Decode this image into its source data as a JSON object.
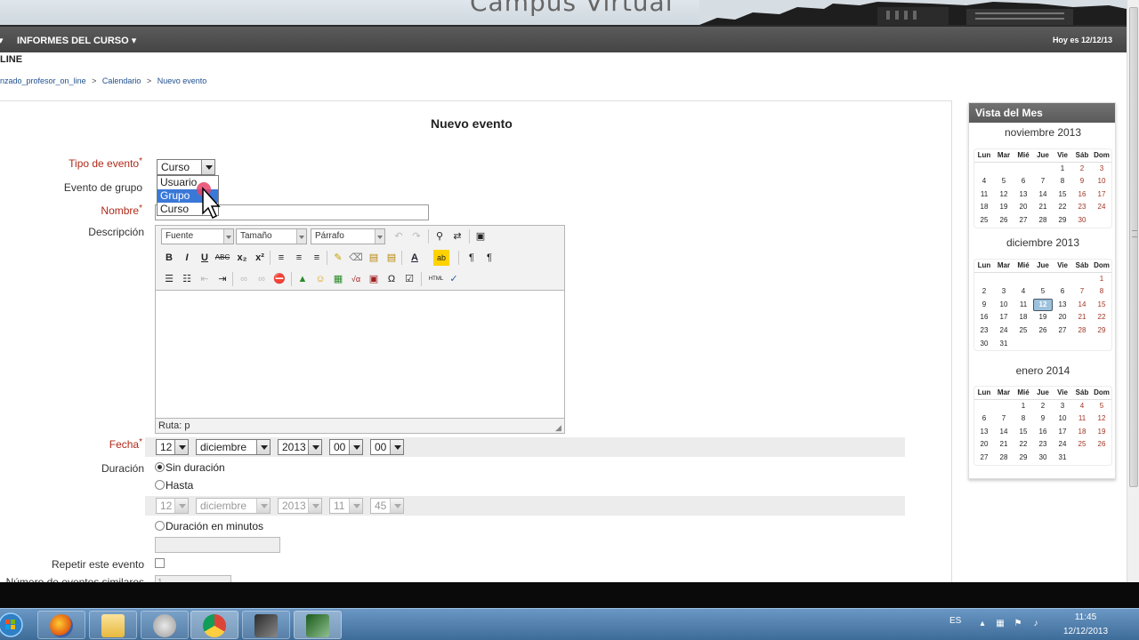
{
  "banner": {
    "title": "Campus Virtual"
  },
  "nav": {
    "left_chevron": "▾",
    "informes": "INFORMES DEL CURSO ▾",
    "today": "Hoy es 12/12/13"
  },
  "course_short": "LINE",
  "breadcrumb": {
    "items": [
      "nzado_profesor_on_line",
      "Calendario",
      "Nuevo evento"
    ],
    "separator": ">"
  },
  "form": {
    "title": "Nuevo evento",
    "tipo_label": "Tipo de evento",
    "tipo_value": "Curso",
    "tipo_options": [
      "Usuario",
      "Grupo",
      "Curso"
    ],
    "grupo_label": "Evento de grupo",
    "nombre_label": "Nombre",
    "descripcion_label": "Descripción",
    "fecha_label": "Fecha",
    "duracion_label": "Duración",
    "sin_duracion": "Sin duración",
    "hasta": "Hasta",
    "duracion_minutos": "Duración en minutos",
    "repetir_label": "Repetir este evento",
    "numero_label": "Número de eventos similares",
    "numero_value": "1",
    "required_star": "*"
  },
  "editor": {
    "font": "Fuente",
    "size": "Tamaño",
    "format": "Párrafo",
    "path": "Ruta: p",
    "row2": [
      "B",
      "I",
      "U",
      "ABC",
      "x₂",
      "x²",
      "≡",
      "≡",
      "≡",
      "✎",
      "⌫",
      "▤",
      "▤",
      "A",
      "ab",
      "¶",
      "¶"
    ],
    "row3": [
      "☰",
      "☷",
      "⇤",
      "⇥",
      "∞",
      "∞",
      "⛔",
      "▲",
      "☺",
      "▦",
      "√α",
      "▣",
      "Ω",
      "☑",
      "HTML"
    ]
  },
  "fecha": {
    "day": "12",
    "month": "diciembre",
    "year": "2013",
    "hour": "00",
    "minute": "00"
  },
  "hasta": {
    "day": "12",
    "month": "diciembre",
    "year": "2013",
    "hour": "11",
    "minute": "45"
  },
  "sidebar": {
    "title": "Vista del Mes",
    "weekdays": [
      "Lun",
      "Mar",
      "Mié",
      "Jue",
      "Vie",
      "Sáb",
      "Dom"
    ],
    "months": [
      {
        "name": "noviembre 2013",
        "weeks": [
          [
            "",
            "",
            "",
            "",
            "1",
            "2",
            "3"
          ],
          [
            "4",
            "5",
            "6",
            "7",
            "8",
            "9",
            "10"
          ],
          [
            "11",
            "12",
            "13",
            "14",
            "15",
            "16",
            "17"
          ],
          [
            "18",
            "19",
            "20",
            "21",
            "22",
            "23",
            "24"
          ],
          [
            "25",
            "26",
            "27",
            "28",
            "29",
            "30",
            ""
          ]
        ]
      },
      {
        "name": "diciembre 2013",
        "weeks": [
          [
            "",
            "",
            "",
            "",
            "",
            "",
            "1"
          ],
          [
            "2",
            "3",
            "4",
            "5",
            "6",
            "7",
            "8"
          ],
          [
            "9",
            "10",
            "11",
            "12",
            "13",
            "14",
            "15"
          ],
          [
            "16",
            "17",
            "18",
            "19",
            "20",
            "21",
            "22"
          ],
          [
            "23",
            "24",
            "25",
            "26",
            "27",
            "28",
            "29"
          ],
          [
            "30",
            "31",
            "",
            "",
            "",
            "",
            ""
          ]
        ],
        "today": "12"
      },
      {
        "name": "enero 2014",
        "weeks": [
          [
            "",
            "",
            "1",
            "2",
            "3",
            "4",
            "5"
          ],
          [
            "6",
            "7",
            "8",
            "9",
            "10",
            "11",
            "12"
          ],
          [
            "13",
            "14",
            "15",
            "16",
            "17",
            "18",
            "19"
          ],
          [
            "20",
            "21",
            "22",
            "23",
            "24",
            "25",
            "26"
          ],
          [
            "27",
            "28",
            "29",
            "30",
            "31",
            "",
            ""
          ]
        ]
      }
    ]
  },
  "taskbar": {
    "lang": "ES",
    "time": "11:45",
    "date": "12/12/2013",
    "apps": [
      "firefox-icon",
      "explorer-icon",
      "media-player-icon",
      "chrome-icon",
      "app-icon",
      "app-icon-2"
    ]
  }
}
